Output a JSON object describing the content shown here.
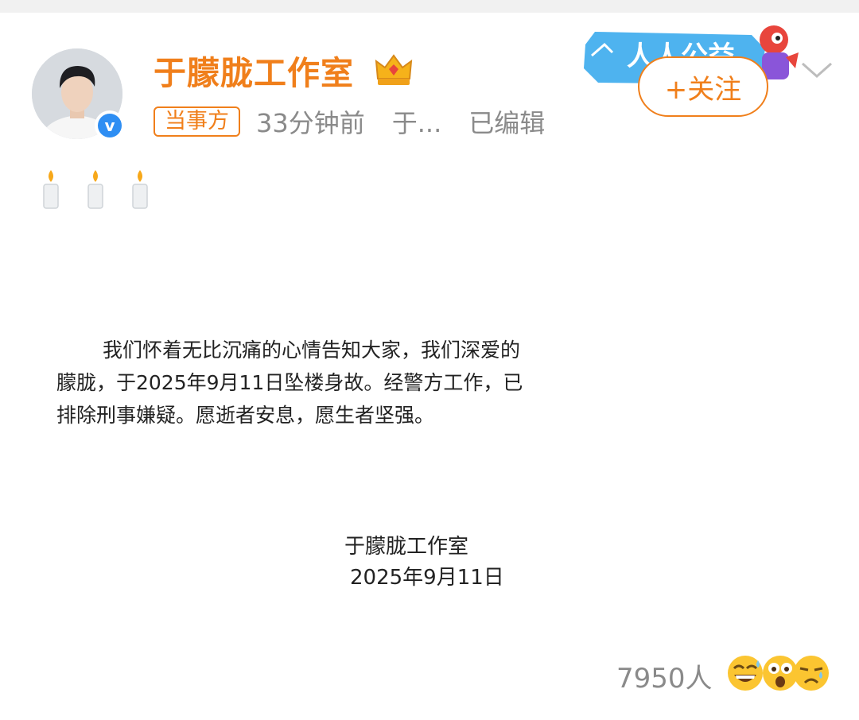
{
  "post": {
    "author": "于朦胧工作室",
    "badge": "当事方",
    "time": "33分钟前",
    "source": "于...",
    "edited": "已编辑",
    "follow_label": "+关注",
    "banner_text": "人人公益",
    "body": "我们怀着无比沉痛的心情告知大家，我们深爱的朦胧，于2025年9月11日坠楼身故。经警方工作，已排除刑事嫌疑。愿逝者安息，愿生者坚强。",
    "signature_name": "于朦胧工作室",
    "signature_date": "2025年9月11日",
    "reaction_count": "7950人"
  },
  "icons": {
    "crown": "crown-icon",
    "verified": "verified-v-icon",
    "candle": "candle-icon",
    "chevron": "chevron-down-icon",
    "reactions": [
      "grinning-sweat-emoji",
      "astonished-emoji",
      "sad-emoji"
    ]
  },
  "colors": {
    "accent": "#f07f1b",
    "verified": "#2e8ef3",
    "meta_gray": "#8a8a8a"
  }
}
